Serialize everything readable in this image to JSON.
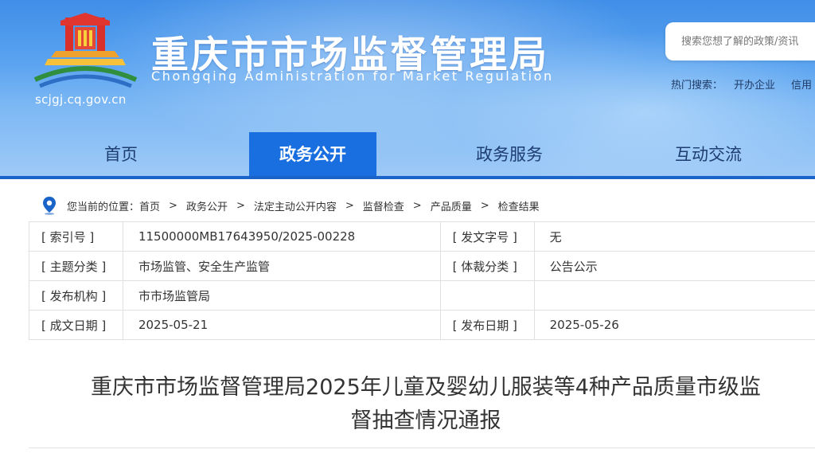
{
  "header": {
    "title": "重庆市市场监督管理局",
    "subtitle": "Chongqing  Administration for Market Regulation",
    "domain": "scjgj.cq.gov.cn",
    "logo_icon": "municipal-emblem-icon",
    "colors": {
      "header_bg": "#4a97ec",
      "nav_active": "#1a6fe0",
      "nav_active_underline": "#d81e2c",
      "nav_text": "#1e3d70"
    }
  },
  "search": {
    "placeholder": "搜索您想了解的政策/资讯",
    "hot_label": "热门搜索：",
    "hot_items": [
      "开办企业",
      "信用"
    ]
  },
  "nav": {
    "items": [
      {
        "label": "首页"
      },
      {
        "label": "政务公开",
        "active": true
      },
      {
        "label": "政务服务"
      },
      {
        "label": "互动交流"
      }
    ]
  },
  "breadcrumb": {
    "icon": "location-pin-icon",
    "prefix": "您当前的位置：",
    "items": [
      "首页",
      "政务公开",
      "法定主动公开内容",
      "监督检查",
      "产品质量",
      "检查结果"
    ],
    "separator": ">"
  },
  "info": {
    "index_label": "[ 索引号 ]",
    "index_value": "11500000MB17643950/2025-00228",
    "doc_no_label": "[ 发文字号 ]",
    "doc_no_value": "无",
    "topic_label": "[ 主题分类 ]",
    "topic_value": "市场监管、安全生产监管",
    "genre_label": "[ 体裁分类 ]",
    "genre_value": "公告公示",
    "org_label": "[ 发布机构 ]",
    "org_value": "市市场监管局",
    "created_label": "[ 成文日期 ]",
    "created_value": "2025-05-21",
    "published_label": "[ 发布日期 ]",
    "published_value": "2025-05-26"
  },
  "article": {
    "title_line1": "重庆市市场监督管理局2025年儿童及婴幼儿服装等4种产品质量市级监",
    "title_line2": "督抽查情况通报"
  }
}
